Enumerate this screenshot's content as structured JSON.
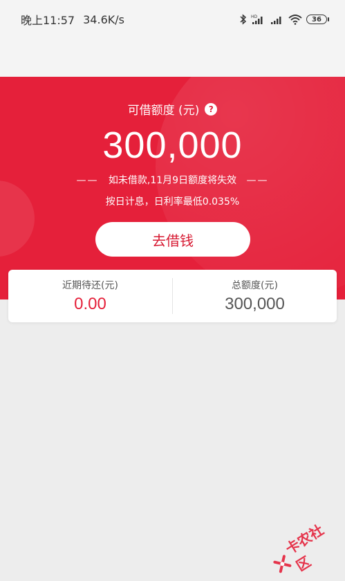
{
  "status_bar": {
    "time": "晚上11:57",
    "speed": "34.6K/s",
    "battery": "36",
    "icons": [
      "bluetooth-icon",
      "hd-signal-icon",
      "signal-icon",
      "wifi-icon",
      "battery-icon"
    ]
  },
  "credit": {
    "label": "可借额度 (元)",
    "help_icon": "?",
    "amount": "300,000",
    "expire_dash": "——",
    "expire_text": "如未借款,11月9日额度将失效",
    "interest_text": "按日计息，日利率最低0.035%"
  },
  "borrow_button": {
    "label": "去借钱"
  },
  "summary": {
    "due_label": "近期待还(元)",
    "due_value": "0.00",
    "total_label": "总额度(元)",
    "total_value": "300,000"
  },
  "watermark": {
    "text": "卡农社区"
  },
  "colors": {
    "primary_red": "#e5203a",
    "background": "#ededed",
    "status_bar_bg": "#f4f4f4"
  }
}
